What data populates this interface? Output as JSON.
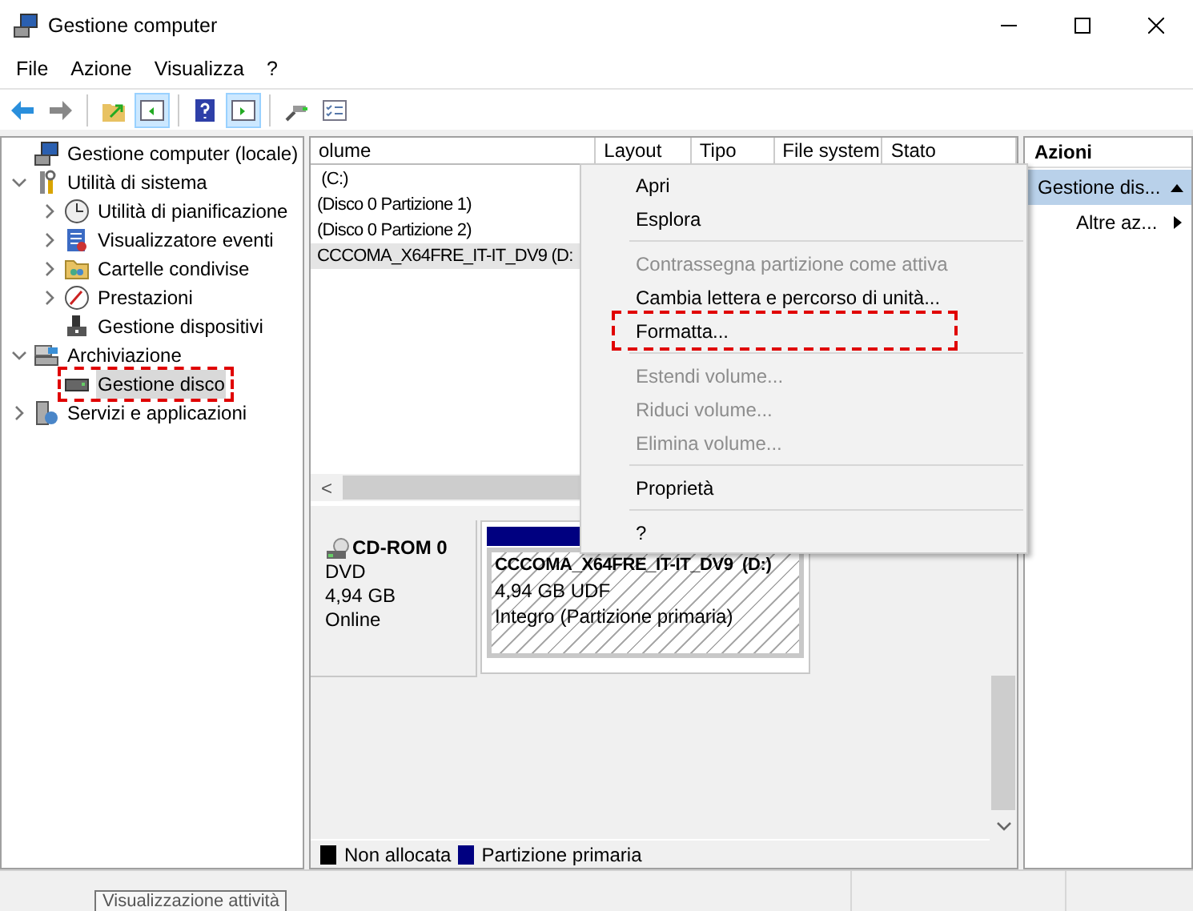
{
  "window": {
    "title": "Gestione computer"
  },
  "menu_bar": [
    "File",
    "Azione",
    "Visualizza",
    "?"
  ],
  "toolbar": [
    {
      "kind": "back"
    },
    {
      "kind": "forward"
    },
    {
      "kind": "sep"
    },
    {
      "kind": "up"
    },
    {
      "kind": "pane-left",
      "selected": true
    },
    {
      "kind": "sep"
    },
    {
      "kind": "help"
    },
    {
      "kind": "pane-right",
      "selected": true
    },
    {
      "kind": "sep"
    },
    {
      "kind": "connect"
    },
    {
      "kind": "checklist"
    }
  ],
  "tree": [
    {
      "label": "Gestione computer (locale)",
      "kind": "computer",
      "selected": false,
      "children": [
        {
          "label": "Utilità di sistema",
          "kind": "tools",
          "expanded": true,
          "selected": false,
          "children": [
            {
              "label": "Utilità di pianificazione",
              "kind": "clock",
              "expanded": false,
              "selected": false
            },
            {
              "label": "Visualizzatore eventi",
              "kind": "log",
              "expanded": false,
              "selected": false
            },
            {
              "label": "Cartelle condivise",
              "kind": "folder",
              "expanded": false,
              "selected": false
            },
            {
              "label": "Prestazioni",
              "kind": "gauge",
              "expanded": false,
              "selected": false
            },
            {
              "label": "Gestione dispositivi",
              "kind": "device",
              "selected": false
            }
          ]
        },
        {
          "label": "Archiviazione",
          "kind": "storage",
          "expanded": true,
          "selected": false,
          "children": [
            {
              "label": "Gestione disco",
              "kind": "disk",
              "selected": true,
              "highlighted": true
            }
          ]
        },
        {
          "label": "Servizi e applicazioni",
          "kind": "services",
          "expanded": false,
          "selected": false
        }
      ]
    }
  ],
  "volume_table": {
    "columns": [
      "olume",
      "Layout",
      "Tipo",
      "File system",
      "Stato"
    ],
    "rows": [
      {
        "volume": " (C:)",
        "selected": false
      },
      {
        "volume": "(Disco 0 Partizione 1)",
        "selected": false
      },
      {
        "volume": "(Disco 0 Partizione 2)",
        "selected": false
      },
      {
        "volume": "CCCOMA_X64FRE_IT-IT_DV9 (D:",
        "selected": true
      }
    ],
    "scroll_left": "<"
  },
  "context_menu": [
    {
      "kind": "item",
      "label": "Apri",
      "disabled": false
    },
    {
      "kind": "item",
      "label": "Esplora",
      "disabled": false
    },
    {
      "kind": "separator"
    },
    {
      "kind": "item",
      "label": "Contrassegna partizione come attiva",
      "disabled": true
    },
    {
      "kind": "item",
      "label": "Cambia lettera e percorso di unità...",
      "disabled": false
    },
    {
      "kind": "item",
      "label": "Formatta...",
      "disabled": false,
      "highlighted": true
    },
    {
      "kind": "separator"
    },
    {
      "kind": "item",
      "label": "Estendi volume...",
      "disabled": true
    },
    {
      "kind": "item",
      "label": "Riduci volume...",
      "disabled": true
    },
    {
      "kind": "item",
      "label": "Elimina volume...",
      "disabled": true
    },
    {
      "kind": "separator"
    },
    {
      "kind": "item",
      "label": "Proprietà",
      "disabled": false
    },
    {
      "kind": "separator"
    },
    {
      "kind": "item",
      "label": "?",
      "disabled": false
    }
  ],
  "disk": {
    "name": "CD-ROM 0",
    "details": [
      "DVD",
      "4,94 GB",
      "Online"
    ],
    "partition": {
      "title": "CCCOMA_X64FRE_IT-IT_DV9  (D:)",
      "details": [
        "4,94 GB UDF",
        "Integro (Partizione primaria)"
      ],
      "color": "#000080"
    }
  },
  "legend": [
    {
      "label": "Non allocata",
      "color": "#000000"
    },
    {
      "label": "Partizione primaria",
      "color": "#000080"
    }
  ],
  "actions": {
    "title": "Azioni",
    "items": [
      {
        "kind": "section",
        "label": "Gestione dis..."
      },
      {
        "kind": "submenu",
        "label": "Altre az..."
      }
    ]
  },
  "tooltip": "Visualizzazione attività"
}
